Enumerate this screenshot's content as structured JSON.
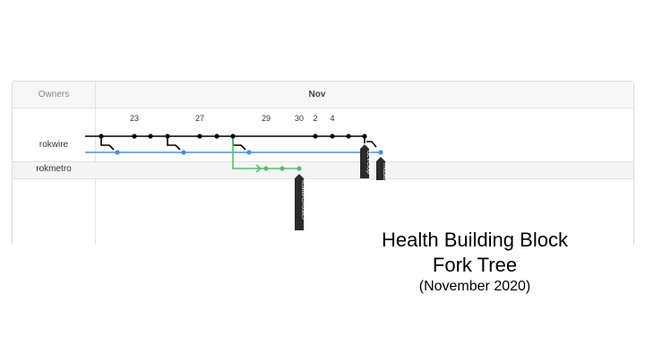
{
  "network": {
    "owners_header": "Owners",
    "month_header": "Nov",
    "dates": [
      {
        "label": "23"
      },
      {
        "label": "27"
      },
      {
        "label": "29"
      },
      {
        "label": "30"
      },
      {
        "label": "2"
      },
      {
        "label": "4"
      }
    ],
    "owners": [
      {
        "name": "rokwire"
      },
      {
        "name": "rokmetro"
      }
    ],
    "branch_labels": {
      "develop": "develop",
      "master": "master",
      "feature": "feature/roster"
    },
    "colors": {
      "develop_line": "#000000",
      "master_line": "#4a90d9",
      "feature_line": "#5cbf6e",
      "label_bg": "#2b2b2b"
    }
  },
  "caption": {
    "line1": "Health Building Block",
    "line2": "Fork Tree",
    "line3": "(November 2020)"
  }
}
